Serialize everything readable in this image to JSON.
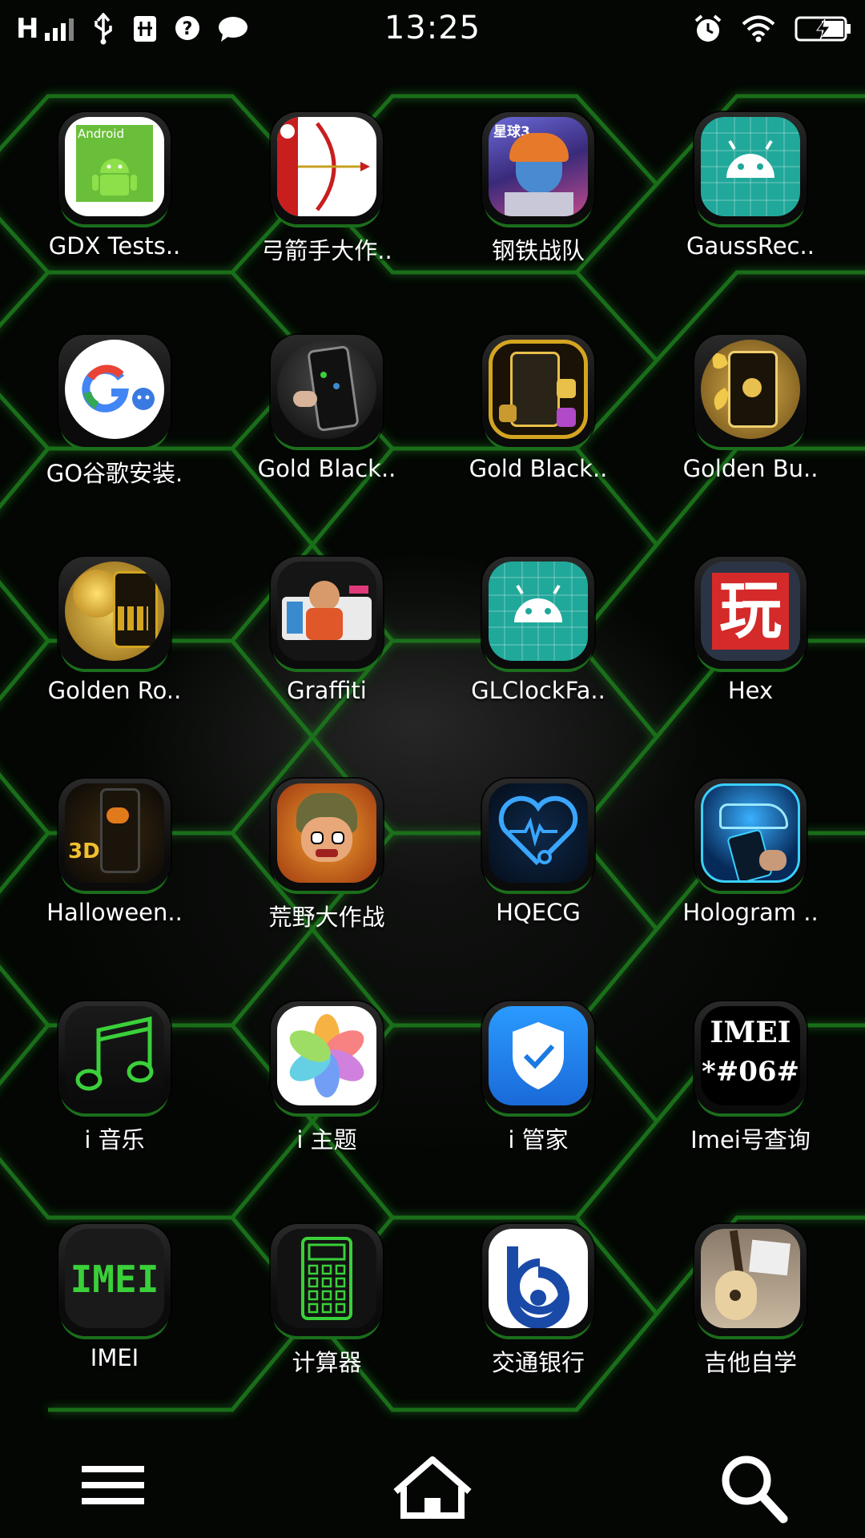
{
  "status_bar": {
    "network_type": "H",
    "time": "13:25",
    "icons": [
      "usb-icon",
      "usb-debug-icon",
      "help-icon",
      "message-icon",
      "alarm-icon",
      "wifi-icon",
      "battery-charging-icon"
    ]
  },
  "apps": [
    {
      "label": "GDX Tests..",
      "icon": "android-icon"
    },
    {
      "label": "弓箭手大作..",
      "icon": "archer-bow-icon"
    },
    {
      "label": "钢铁战队",
      "icon": "game-hero-icon"
    },
    {
      "label": "GaussRec..",
      "icon": "android-teal-icon"
    },
    {
      "label": "GO谷歌安装.",
      "icon": "google-g-icon"
    },
    {
      "label": "Gold Black..",
      "icon": "phone-theme-icon"
    },
    {
      "label": "Gold Black..",
      "icon": "gold-phone-theme-icon"
    },
    {
      "label": "Golden Bu..",
      "icon": "golden-butterfly-icon"
    },
    {
      "label": "Golden Ro..",
      "icon": "golden-rose-icon"
    },
    {
      "label": "Graffiti",
      "icon": "graffiti-icon"
    },
    {
      "label": "GLClockFa..",
      "icon": "android-teal-icon"
    },
    {
      "label": "Hex",
      "icon": "hex-wan-icon"
    },
    {
      "label": "Halloween..",
      "icon": "halloween-icon"
    },
    {
      "label": "荒野大作战",
      "icon": "wild-battle-icon"
    },
    {
      "label": "HQECG",
      "icon": "heart-ecg-icon"
    },
    {
      "label": "Hologram ..",
      "icon": "hologram-car-icon"
    },
    {
      "label": "i 音乐",
      "icon": "music-note-icon"
    },
    {
      "label": "i 主题",
      "icon": "pinwheel-icon"
    },
    {
      "label": "i 管家",
      "icon": "shield-check-icon"
    },
    {
      "label": "Imei号查询",
      "icon": "imei-code-icon"
    },
    {
      "label": "IMEI",
      "icon": "imei-text-icon"
    },
    {
      "label": "计算器",
      "icon": "calculator-icon"
    },
    {
      "label": "交通银行",
      "icon": "bank-logo-icon"
    },
    {
      "label": "吉他自学",
      "icon": "guitar-icon"
    }
  ],
  "icon_text": {
    "imei_code_line1": "IMEI",
    "imei_code_line2": "*#06#",
    "imei_green": "IMEI",
    "hex_char": "玩",
    "android_badge": "Android",
    "xingqiu": "星球3",
    "halloween_3d": "3D"
  },
  "dock": {
    "items": [
      "menu-icon",
      "home-icon",
      "search-icon"
    ]
  },
  "colors": {
    "accent_green": "#2ecc2e",
    "teal": "#20a89a",
    "ecg_blue": "#3aa6ff"
  }
}
